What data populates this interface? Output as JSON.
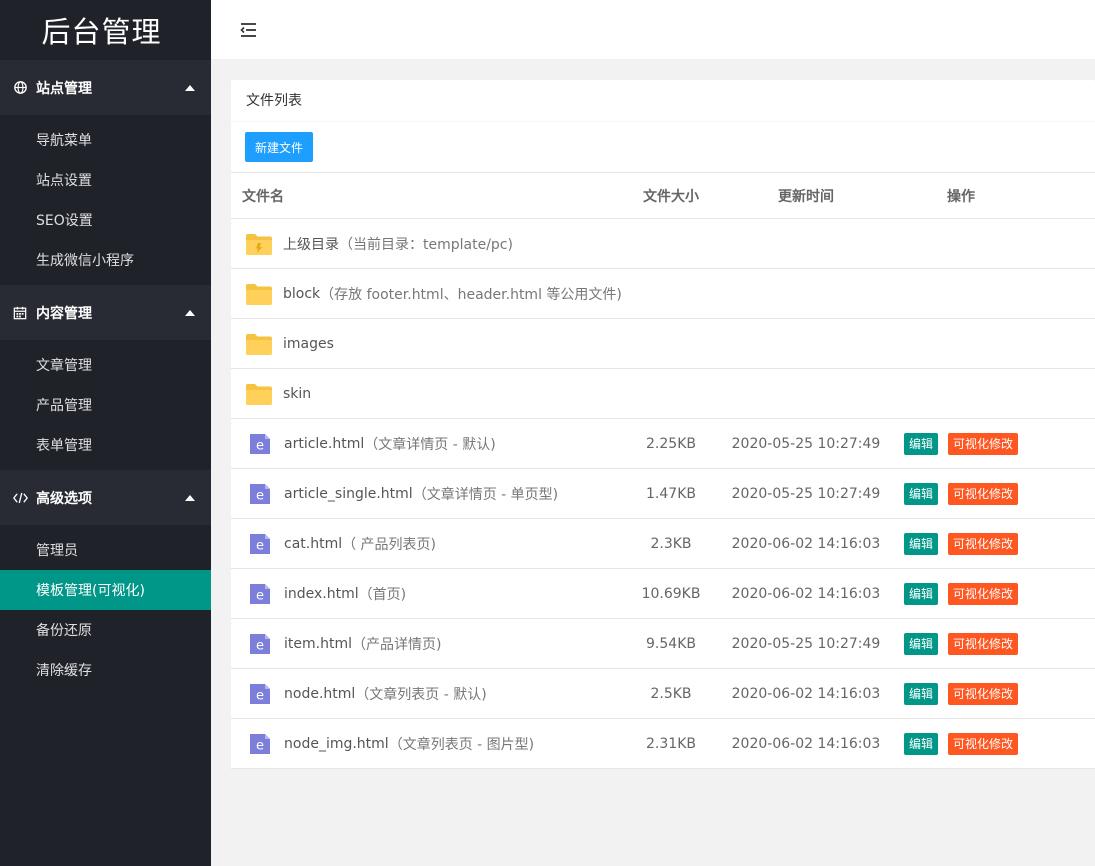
{
  "sidebar": {
    "logo": "后台管理",
    "groups": [
      {
        "icon": "globe-icon",
        "label": "站点管理",
        "items": [
          "导航菜单",
          "站点设置",
          "SEO设置",
          "生成微信小程序"
        ]
      },
      {
        "icon": "calendar-icon",
        "label": "内容管理",
        "items": [
          "文章管理",
          "产品管理",
          "表单管理"
        ]
      },
      {
        "icon": "code-icon",
        "label": "高级选项",
        "items": [
          "管理员",
          "模板管理(可视化)",
          "备份还原",
          "清除缓存"
        ]
      }
    ],
    "active_item": "模板管理(可视化)"
  },
  "card": {
    "title": "文件列表",
    "new_button": "新建文件"
  },
  "table": {
    "headers": {
      "name": "文件名",
      "size": "文件大小",
      "time": "更新时间",
      "ops": "操作"
    },
    "folders": [
      {
        "name": "上级目录",
        "note": "（当前目录：template/pc)",
        "icon": "parent-folder-icon"
      },
      {
        "name": "block",
        "note": "（存放 footer.html、header.html 等公用文件)",
        "icon": "folder-icon"
      },
      {
        "name": "images",
        "note": "",
        "icon": "folder-icon"
      },
      {
        "name": "skin",
        "note": "",
        "icon": "folder-icon"
      }
    ],
    "files": [
      {
        "name": "article.html",
        "note": "（文章详情页 - 默认)",
        "size": "2.25KB",
        "time": "2020-05-25 10:27:49"
      },
      {
        "name": "article_single.html",
        "note": "（文章详情页 - 单页型)",
        "size": "1.47KB",
        "time": "2020-05-25 10:27:49"
      },
      {
        "name": "cat.html",
        "note": "（ 产品列表页)",
        "size": "2.3KB",
        "time": "2020-06-02 14:16:03"
      },
      {
        "name": "index.html",
        "note": "（首页)",
        "size": "10.69KB",
        "time": "2020-06-02 14:16:03"
      },
      {
        "name": "item.html",
        "note": "（产品详情页)",
        "size": "9.54KB",
        "time": "2020-05-25 10:27:49"
      },
      {
        "name": "node.html",
        "note": "（文章列表页 - 默认)",
        "size": "2.5KB",
        "time": "2020-06-02 14:16:03"
      },
      {
        "name": "node_img.html",
        "note": "（文章列表页 - 图片型)",
        "size": "2.31KB",
        "time": "2020-06-02 14:16:03"
      }
    ],
    "edit_label": "编辑",
    "visual_label": "可视化修改"
  },
  "colors": {
    "sidebar_bg": "#20222a",
    "group_bg": "#282b33",
    "active": "#009688",
    "primary_button": "#1e9fff",
    "danger_button": "#ff5722",
    "folder": "#ffd15b",
    "doc_icon": "#7b7fd9"
  }
}
